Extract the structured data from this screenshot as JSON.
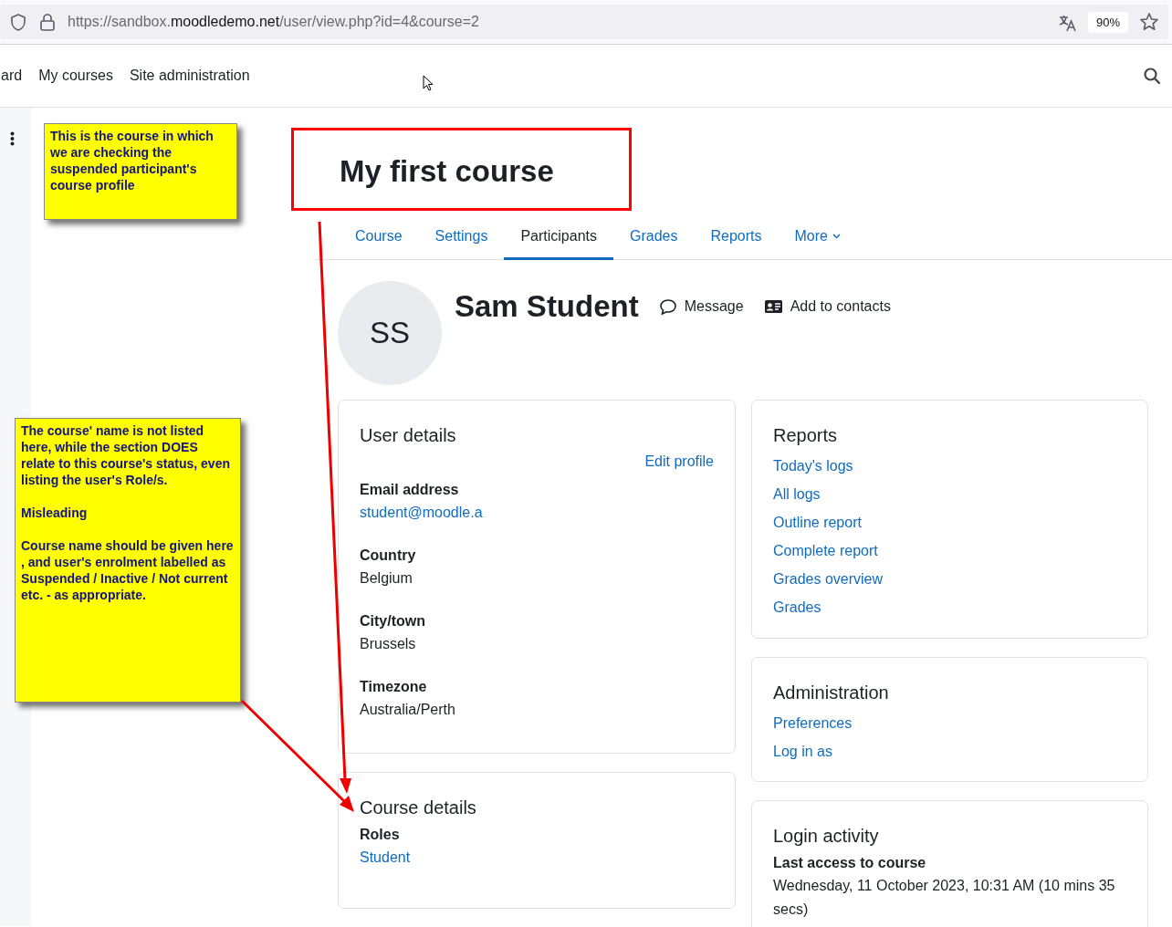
{
  "browser": {
    "url_scheme_sub": "https://sandbox.",
    "url_host": "moodledemo.net",
    "url_path": "/user/view.php?id=4&course=2",
    "zoom": "90%"
  },
  "navbar": {
    "items": [
      {
        "label": "ard"
      },
      {
        "label": "My courses"
      },
      {
        "label": "Site administration"
      }
    ]
  },
  "course": {
    "title": "My first course",
    "tabs": [
      {
        "label": "Course",
        "selected": false
      },
      {
        "label": "Settings",
        "selected": false
      },
      {
        "label": "Participants",
        "selected": true
      },
      {
        "label": "Grades",
        "selected": false
      },
      {
        "label": "Reports",
        "selected": false
      },
      {
        "label": "More",
        "selected": false,
        "kind": "dropdown"
      }
    ]
  },
  "profile": {
    "initials": "SS",
    "name": "Sam Student",
    "actions": [
      {
        "kind": "message",
        "label": "Message"
      },
      {
        "kind": "contacts",
        "label": "Add to contacts"
      }
    ]
  },
  "user_details": {
    "title": "User details",
    "edit_link": "Edit profile",
    "fields": [
      {
        "label": "Email address",
        "value": "student@moodle.a",
        "kind": "link"
      },
      {
        "label": "Country",
        "value": "Belgium",
        "kind": "text"
      },
      {
        "label": "City/town",
        "value": "Brussels",
        "kind": "text"
      },
      {
        "label": "Timezone",
        "value": "Australia/Perth",
        "kind": "text"
      }
    ]
  },
  "course_details": {
    "title": "Course details",
    "fields": [
      {
        "label": "Roles",
        "value": "Student",
        "kind": "link"
      }
    ]
  },
  "reports": {
    "title": "Reports",
    "links": [
      "Today's logs",
      "All logs",
      "Outline report",
      "Complete report",
      "Grades overview",
      "Grades"
    ]
  },
  "administration": {
    "title": "Administration",
    "links": [
      "Preferences",
      "Log in as"
    ]
  },
  "login_activity": {
    "title": "Login activity",
    "fields": [
      {
        "label": "Last access to course",
        "value": "Wednesday, 11 October 2023, 10:31 AM  (10 mins 35 secs)",
        "kind": "text"
      }
    ]
  },
  "annotations": {
    "notes": [
      {
        "paragraphs": [
          "This is the course in which we are checking the suspended participant's course profile"
        ]
      },
      {
        "paragraphs": [
          "The course' name is not listed here, while the section DOES relate to this course's status, even listing the user's Role/s.",
          "Misleading",
          "Course name should be given here , and user's enrolment labelled as Suspended / Inactive / Not current etc. - as appropriate."
        ]
      }
    ]
  }
}
